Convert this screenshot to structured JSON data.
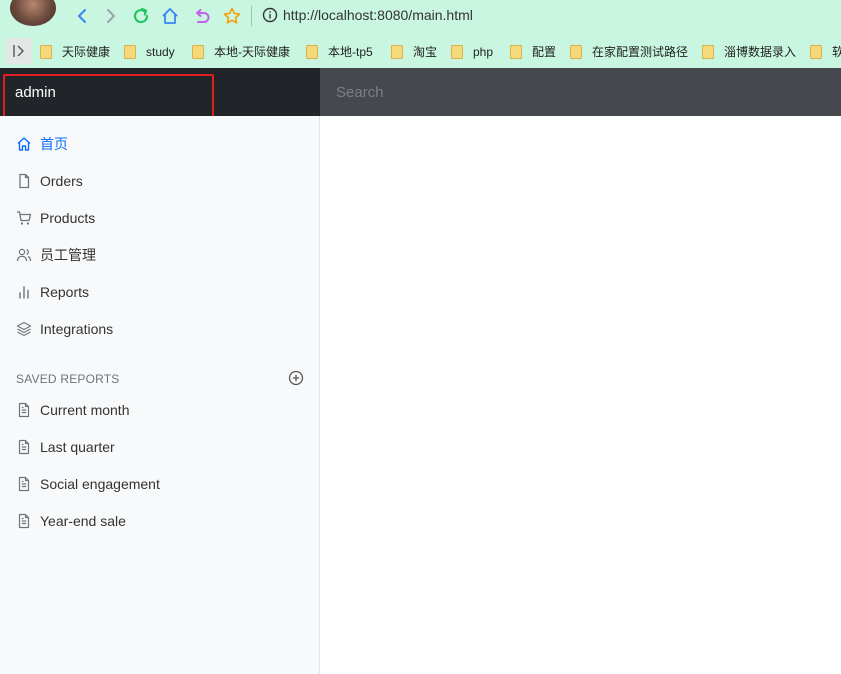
{
  "browser": {
    "url": "http://localhost:8080/main.html",
    "bookmarks": [
      "天际健康",
      "study",
      "本地-天际健康",
      "本地-tp5",
      "淘宝",
      "php",
      "配置",
      "在家配置测试路径",
      "淄博数据录入",
      "软"
    ]
  },
  "header": {
    "brand": "admin",
    "search_placeholder": "Search"
  },
  "sidebar": {
    "nav": [
      {
        "label": "首页",
        "icon": "home-icon",
        "active": true
      },
      {
        "label": "Orders",
        "icon": "file-icon"
      },
      {
        "label": "Products",
        "icon": "cart-icon"
      },
      {
        "label": "员工管理",
        "icon": "users-icon"
      },
      {
        "label": "Reports",
        "icon": "bar-chart-icon"
      },
      {
        "label": "Integrations",
        "icon": "layers-icon"
      }
    ],
    "saved_reports_heading": "SAVED REPORTS",
    "saved_reports": [
      {
        "label": "Current month",
        "icon": "file-text-icon"
      },
      {
        "label": "Last quarter",
        "icon": "file-text-icon"
      },
      {
        "label": "Social engagement",
        "icon": "file-text-icon"
      },
      {
        "label": "Year-end sale",
        "icon": "file-text-icon"
      }
    ]
  },
  "colors": {
    "browser_bar": "#c9f6e0",
    "brand_bg": "#212529",
    "search_bg": "#45484c",
    "sidebar_bg": "#f8f9fa",
    "active_link": "#0d6efd",
    "highlight": "#e02020"
  }
}
